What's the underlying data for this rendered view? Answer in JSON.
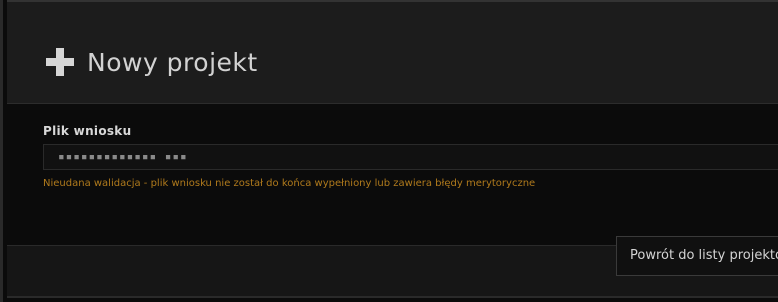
{
  "header": {
    "icon": "plus-icon",
    "title": "Nowy projekt"
  },
  "form": {
    "file_label": "Plik wniosku",
    "file_value": "▪▪▪▪▪▪▪▪▪▪▪▪▪ ▪▪▪",
    "error": "Nieudana walidacja - plik wniosku nie został do końca wypełniony lub zawiera błędy merytoryczne"
  },
  "footer": {
    "back_label": "Powrót do listy projektów"
  },
  "colors": {
    "background": "#0b0b0b",
    "header_bg": "#1c1c1c",
    "error": "#b07a1c",
    "text": "#d2d2d2"
  }
}
